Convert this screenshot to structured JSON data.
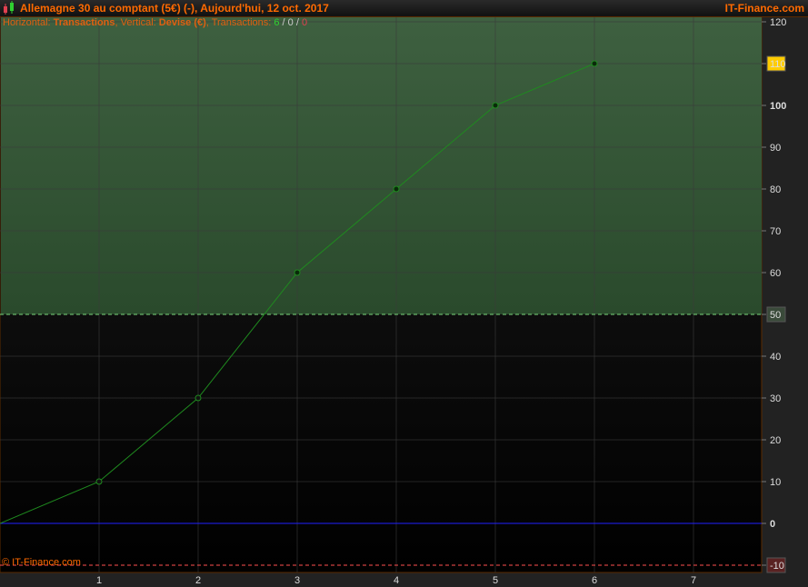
{
  "header": {
    "title": "Allemagne 30 au comptant (5€) (-), Aujourd'hui, 12 oct. 2017",
    "brand": "IT-Finance.com"
  },
  "subtitle": {
    "h_label": "Horizontal: ",
    "h_value": "Transactions",
    "v_label": ", Vertical: ",
    "v_value": "Devise (€)",
    "t_label": ", Transactions: ",
    "wins": "6",
    "sep1": " / ",
    "neutral": "0",
    "sep2": " / ",
    "losses": "0"
  },
  "copyright": "© IT-Finance.com",
  "colors": {
    "line": "#1f8a1f",
    "profit_zone": "#3a5f3a",
    "baseline": "#2020ff",
    "target": "#7ad67a",
    "stop": "#ff5050",
    "highlight": "#ffcc00"
  },
  "chart_data": {
    "type": "line",
    "x": [
      0,
      1,
      2,
      3,
      4,
      5,
      6
    ],
    "y": [
      0,
      10,
      30,
      60,
      80,
      100,
      110
    ],
    "xlabel": "Transactions",
    "ylabel": "Devise (€)",
    "xlim": [
      0,
      7.69
    ],
    "ylim": [
      -10,
      121.5
    ],
    "xticks": [
      "1",
      "2",
      "3",
      "4",
      "5",
      "6",
      "7"
    ],
    "yticks": [
      "120",
      "110",
      "100",
      "90",
      "80",
      "70",
      "60",
      "50",
      "40",
      "30",
      "20",
      "10",
      "0",
      "-10"
    ],
    "target_level": 50,
    "stop_level": -10,
    "last_value": "110",
    "grid": true
  }
}
